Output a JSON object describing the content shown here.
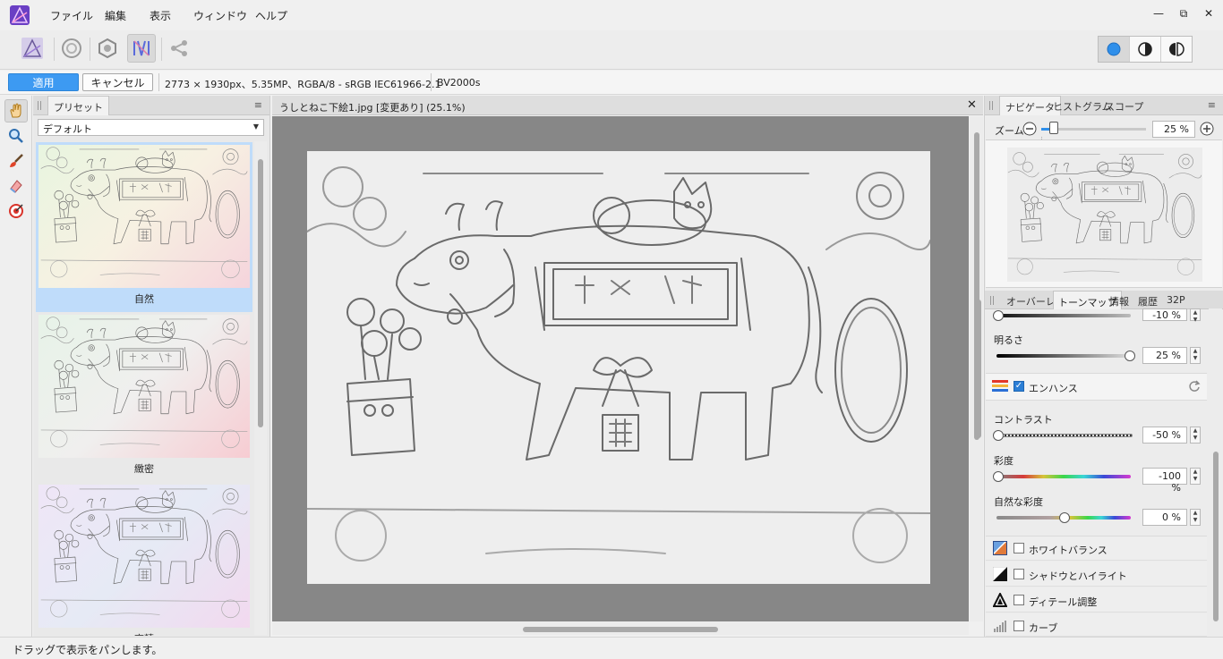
{
  "menu": {
    "items": [
      "ファイル",
      "編集",
      "表示",
      "ウィンドウ",
      "ヘルプ"
    ]
  },
  "window_controls": {
    "minimize": "—",
    "restore": "⧉",
    "close": "✕"
  },
  "context_bar": {
    "apply_label": "適用",
    "cancel_label": "キャンセル",
    "image_info": "2773 × 1930px、5.35MP、RGBA/8 - sRGB IEC61966-2.1",
    "camera": "BV2000s"
  },
  "presets_panel": {
    "tab_label": "プリセット",
    "menu_icon": "≡",
    "selected_preset": "デフォルト",
    "presets": [
      {
        "label": "自然"
      },
      {
        "label": "緻密"
      },
      {
        "label": "高精"
      }
    ]
  },
  "document": {
    "title": "うしとねこ下絵1.jpg [変更あり] (25.1%)",
    "close_icon": "✕"
  },
  "navigator_panel": {
    "tabs": [
      "ナビゲータ",
      "ヒストグラム",
      "スコープ"
    ],
    "zoom_label": "ズーム:",
    "zoom_value": "25 %",
    "zoom_fraction": 0.25
  },
  "adjust_panel": {
    "tabs": [
      "オーバーレイ",
      "トーンマップ",
      "情報",
      "履歴",
      "32P"
    ],
    "partial_value": "-10 %",
    "brightness": {
      "label": "明るさ",
      "value": "25 %"
    },
    "enhance": {
      "label": "エンハンス",
      "checked": true
    },
    "contrast": {
      "label": "コントラスト",
      "value": "-50 %"
    },
    "saturation": {
      "label": "彩度",
      "value": "-100 %"
    },
    "vibrance": {
      "label": "自然な彩度",
      "value": "0 %"
    },
    "groups": [
      {
        "label": "ホワイトバランス",
        "checked": false
      },
      {
        "label": "シャドウとハイライト",
        "checked": false
      },
      {
        "label": "ディテール調整",
        "checked": false
      },
      {
        "label": "カーブ",
        "checked": false
      }
    ]
  },
  "status_bar": {
    "text": "ドラッグで表示をパンします。"
  }
}
